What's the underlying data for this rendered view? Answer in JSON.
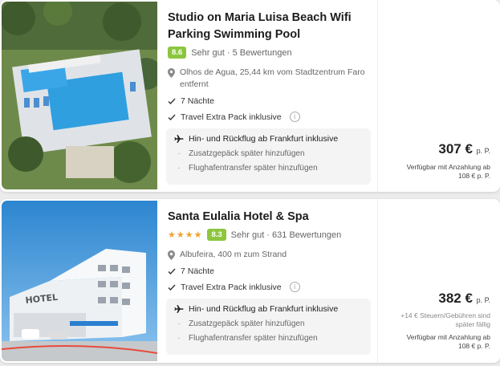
{
  "listings": [
    {
      "title": "Studio on Maria Luisa Beach Wifi Parking Swimming Pool",
      "rating": "8.6",
      "rating_text": "Sehr gut · 5 Bewertungen",
      "location": "Olhos de Agua, 25,44 km vom Stadtzentrum Faro entfernt",
      "nights": "7 Nächte",
      "travel_pack": "Travel Extra Pack inklusive",
      "flight": "Hin- und Rückflug ab Frankfurt inklusive",
      "extra_luggage": "Zusatzgepäck später hinzufügen",
      "transfer": "Flughafentransfer später hinzufügen",
      "price": "307 €",
      "per_person": "p. P.",
      "deposit_note": "Verfügbar mit Anzahlung ab",
      "deposit_amount": "108 € p. P."
    },
    {
      "title": "Santa Eulalia Hotel & Spa",
      "stars": "★★★★",
      "rating": "8.3",
      "rating_text": "Sehr gut · 631 Bewertungen",
      "location": "Albufeira, 400 m zum Strand",
      "nights": "7 Nächte",
      "travel_pack": "Travel Extra Pack inklusive",
      "flight": "Hin- und Rückflug ab Frankfurt inklusive",
      "extra_luggage": "Zusatzgepäck später hinzufügen",
      "transfer": "Flughafentransfer später hinzufügen",
      "price": "382 €",
      "per_person": "p. P.",
      "taxes_note": "+14 € Steuern/Gebühren sind später fällig",
      "deposit_note": "Verfügbar mit Anzahlung ab",
      "deposit_amount": "108 € p. P.",
      "hotel_sign": "HOTEL"
    }
  ],
  "colors": {
    "rating_badge": "#8cc63f",
    "stars": "#f0a22e"
  },
  "icons": [
    "pin-icon",
    "check-icon",
    "info-icon",
    "plane-icon"
  ]
}
